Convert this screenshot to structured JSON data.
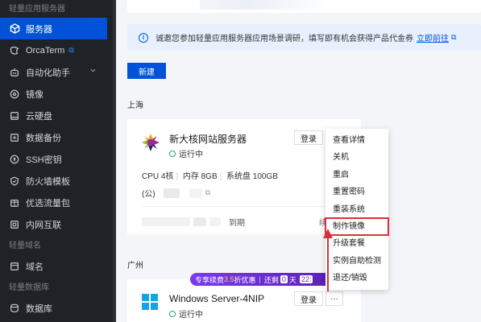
{
  "sidebar": {
    "groups": [
      "轻量应用服务器",
      "轻量域名",
      "轻量数据库"
    ],
    "items": [
      {
        "label": "服务器",
        "icon": "cube-icon",
        "active": true
      },
      {
        "label": "OrcaTerm",
        "icon": "terminal-icon",
        "external": true
      },
      {
        "label": "自动化助手",
        "icon": "robot-icon",
        "expandable": true
      },
      {
        "label": "镜像",
        "icon": "disc-icon"
      },
      {
        "label": "云硬盘",
        "icon": "disk-icon"
      },
      {
        "label": "数据备份",
        "icon": "backup-icon"
      },
      {
        "label": "SSH密钥",
        "icon": "key-icon"
      },
      {
        "label": "防火墙模板",
        "icon": "shield-icon"
      },
      {
        "label": "优选流量包",
        "icon": "package-icon"
      },
      {
        "label": "内网互联",
        "icon": "network-icon"
      },
      {
        "label": "域名",
        "icon": "domain-icon"
      },
      {
        "label": "数据库",
        "icon": "database-icon"
      }
    ]
  },
  "notice": {
    "text": "诚邀您参加轻量应用服务器应用场景调研，填写即有机会获得产品代金券",
    "link": "立即前往"
  },
  "toolbar": {
    "new_label": "新建"
  },
  "regions": [
    {
      "name": "上海",
      "server": {
        "name": "新大核网站服务器",
        "status": "运行中",
        "login_label": "登录",
        "specs": [
          "CPU 4核",
          "内存 8GB",
          "系统盘 100GB"
        ],
        "ip_prefix": "(公)",
        "expire_suffix": "到期",
        "renew_fragment": "续"
      }
    },
    {
      "name": "广州",
      "server": {
        "name": "Windows Server-4NIP",
        "status": "运行中",
        "login_label": "登录"
      }
    }
  ],
  "promo": {
    "text_a": "专享续费",
    "discount": "3.5",
    "text_b": "折优惠",
    "countdown_label": "还剩",
    "days_value": "0",
    "days_unit": "天",
    "time_fragment": "22:"
  },
  "more_menu": {
    "items": [
      "查看详情",
      "关机",
      "重启",
      "重置密码",
      "重装系统",
      "制作镜像",
      "升级套餐",
      "实例自助检测",
      "退还/销毁"
    ],
    "highlighted": "制作镜像"
  },
  "colors": {
    "accent": "#0052d9",
    "highlight": "#d8303b",
    "running": "#2ba471",
    "promo": "#7c3aed"
  }
}
